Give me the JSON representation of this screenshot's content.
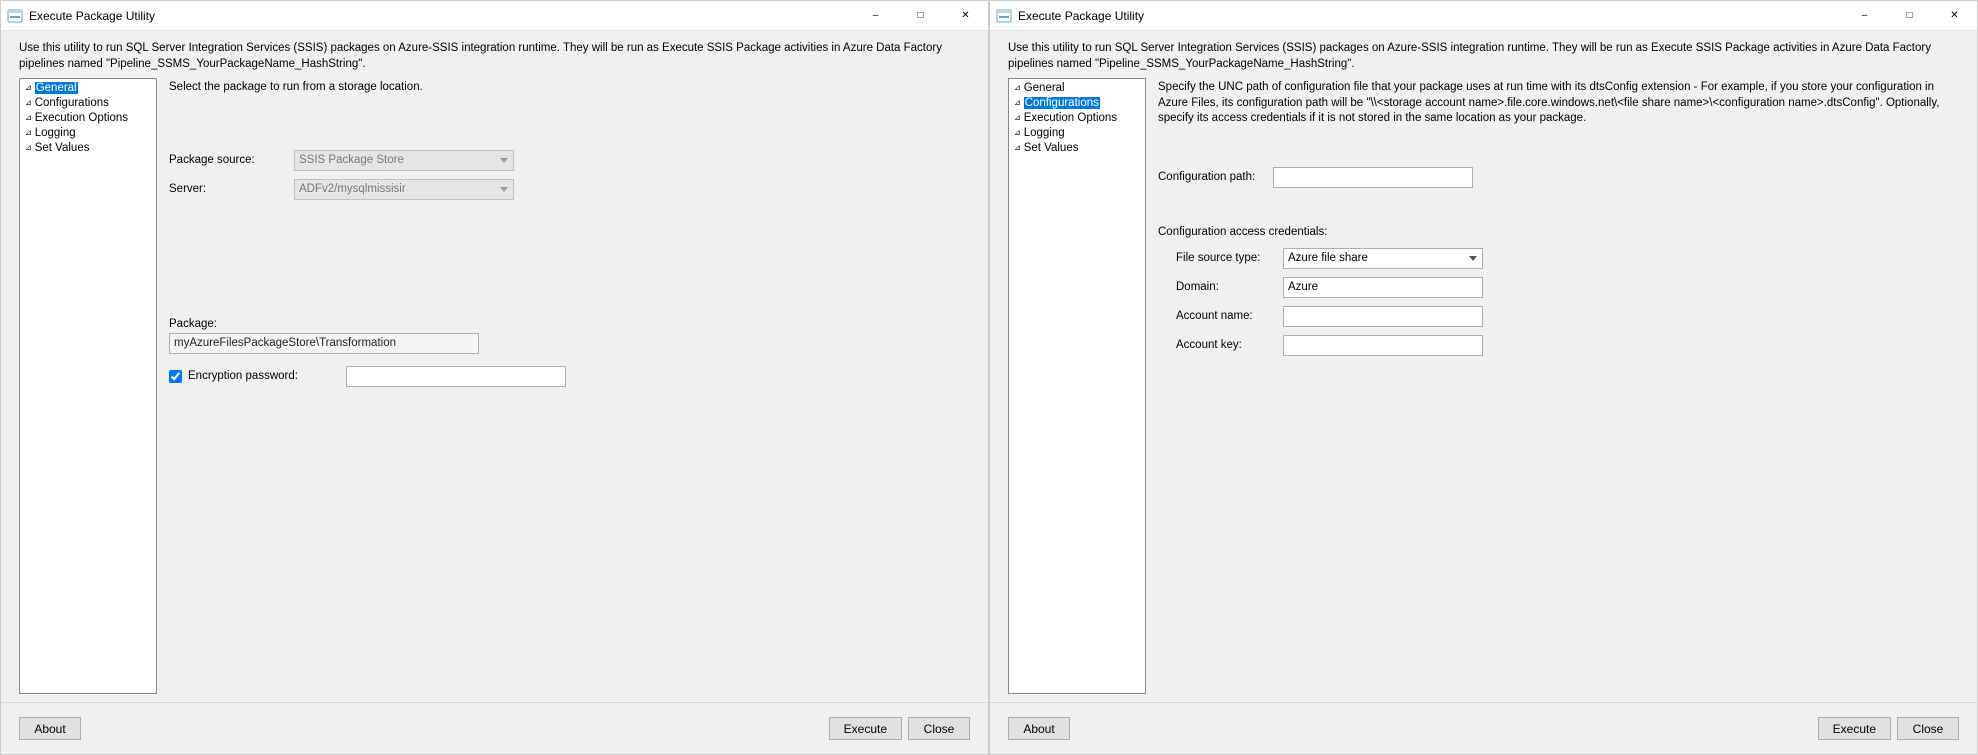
{
  "windows": [
    {
      "title": "Execute Package Utility",
      "description": "Use this utility to run SQL Server Integration Services (SSIS) packages on Azure-SSIS integration runtime. They will be run as Execute SSIS Package activities in Azure Data Factory pipelines named \"Pipeline_SSMS_YourPackageName_HashString\".",
      "nav": {
        "items": [
          {
            "label": "General",
            "selected": true
          },
          {
            "label": "Configurations",
            "selected": false
          },
          {
            "label": "Execution Options",
            "selected": false
          },
          {
            "label": "Logging",
            "selected": false
          },
          {
            "label": "Set Values",
            "selected": false
          }
        ]
      },
      "general": {
        "instruction": "Select the package to run from a storage location.",
        "package_source_label": "Package source:",
        "package_source_value": "SSIS Package Store",
        "server_label": "Server:",
        "server_value": "ADFv2/mysqlmissisir",
        "package_label": "Package:",
        "package_value": "myAzureFilesPackageStore\\Transformation",
        "enc_label": "Encryption password:",
        "enc_checked": true,
        "enc_value": ""
      },
      "footer": {
        "about": "About",
        "execute": "Execute",
        "close": "Close"
      }
    },
    {
      "title": "Execute Package Utility",
      "description": "Use this utility to run SQL Server Integration Services (SSIS) packages on Azure-SSIS integration runtime. They will be run as Execute SSIS Package activities in Azure Data Factory pipelines named \"Pipeline_SSMS_YourPackageName_HashString\".",
      "nav": {
        "items": [
          {
            "label": "General",
            "selected": false
          },
          {
            "label": "Configurations",
            "selected": true
          },
          {
            "label": "Execution Options",
            "selected": false
          },
          {
            "label": "Logging",
            "selected": false
          },
          {
            "label": "Set Values",
            "selected": false
          }
        ]
      },
      "config": {
        "instruction": "Specify the UNC path of configuration file that your package uses at run time with its dtsConfig extension - For example, if you store your configuration in Azure Files, its configuration path will be \"\\\\<storage account name>.file.core.windows.net\\<file share name>\\<configuration name>.dtsConfig\".  Optionally, specify its access credentials if it is not stored in the same location as your package.",
        "path_label": "Configuration path:",
        "path_value": "",
        "cred_heading": "Configuration access credentials:",
        "file_source_label": "File source type:",
        "file_source_value": "Azure file share",
        "domain_label": "Domain:",
        "domain_value": "Azure",
        "account_name_label": "Account name:",
        "account_name_value": "",
        "account_key_label": "Account key:",
        "account_key_value": ""
      },
      "footer": {
        "about": "About",
        "execute": "Execute",
        "close": "Close"
      }
    }
  ]
}
